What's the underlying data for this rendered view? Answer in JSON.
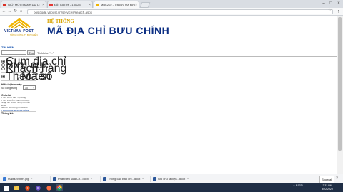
{
  "tabs": [
    {
      "label": "GIỚI MỚI THANH DỰ LỊ",
      "active": false
    },
    {
      "label": "Đỗ: TuoiTre - 1.5123",
      "active": false
    },
    {
      "label": "MBC202 - Tra cứu mã bưu",
      "active": true
    }
  ],
  "address": "postcode.vnpost.vn/services/search.aspx",
  "header": {
    "logo_text": "VIETNAM POST",
    "logo_sub": "TỔNG CÔNG TY BƯU ĐIỆN",
    "system_label": "HỆ THỐNG",
    "title": "MÃ ĐỊA CHỈ BƯU CHÍNH"
  },
  "search": {
    "heading": "TÌM KIẾM...",
    "button_label": "Tìm",
    "input_value": "",
    "keyword_label": "Từ khóa: \"...\""
  },
  "sidebar": {
    "search_types": [
      {
        "label": "Cụm địa chỉ",
        "selected": true
      },
      {
        "label": "Bưu cục",
        "selected": false
      },
      {
        "label": "Khách hàng",
        "selected": false
      }
    ],
    "sort_options": [
      {
        "label": "Theo tên",
        "selected": true
      },
      {
        "label": "Mã số",
        "selected": false
      }
    ],
    "display_label": "Hiển thị/trên máy",
    "per_page_label": "Số dòng/trang",
    "per_page_value": "10",
    "note_label": "Ghi chú:",
    "note_lines": [
      "• Tìm chính xác \"nội dung\"",
      "• Tìm theo tỉnh thành bưu cục",
      "Nhập tên khách hàng và nhấn Enter",
      "để tìm. Số lượng tối đa 100",
      "• Chọn mục Bưu cục để tra"
    ],
    "statistics_label": "Thống Kê:",
    "statistics_value": "..."
  },
  "downloads": [
    {
      "label": "malluu/vnHR.jpg",
      "color": "#3a7bd5"
    },
    {
      "label": "Phát biểu sửa Ch...docx",
      "color": "#2b579a"
    },
    {
      "label": "Thông cáo Báo chí...docx",
      "color": "#2b579a"
    },
    {
      "label": "Ghi chú tài liệu...docx",
      "color": "#2b579a"
    }
  ],
  "show_all_label": "Show all",
  "taskbar": {
    "time": "2:33 PM",
    "date": "8/22/2020"
  }
}
